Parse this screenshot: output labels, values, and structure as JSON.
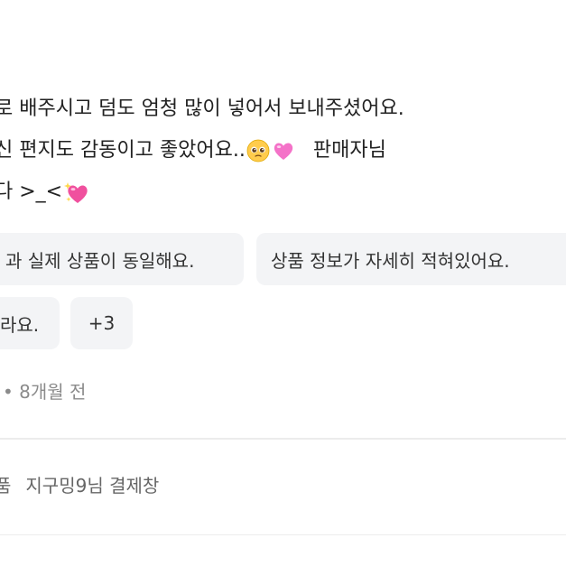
{
  "review": {
    "line1": "로 배주시고 덤도 엄청 많이 넣어서 보내주셨어요.",
    "line2_a": "신 편지도 감동이고 좋았어요..",
    "line2_b": "판매자님",
    "line3": "다 >_<"
  },
  "tags": [
    "과 실제 상품이 동일해요.",
    "상품 정보가 자세히 적혀있어요.",
    "라요.",
    "+3"
  ],
  "meta": {
    "date": "• 8개월 전"
  },
  "product": {
    "prefix": "품",
    "title": "지구밍9님 결제창"
  },
  "icons": {
    "emoji_1": "pleading-face-icon",
    "emoji_2": "pink-heart-icon",
    "emoji_3": "sparkling-heart-icon"
  }
}
